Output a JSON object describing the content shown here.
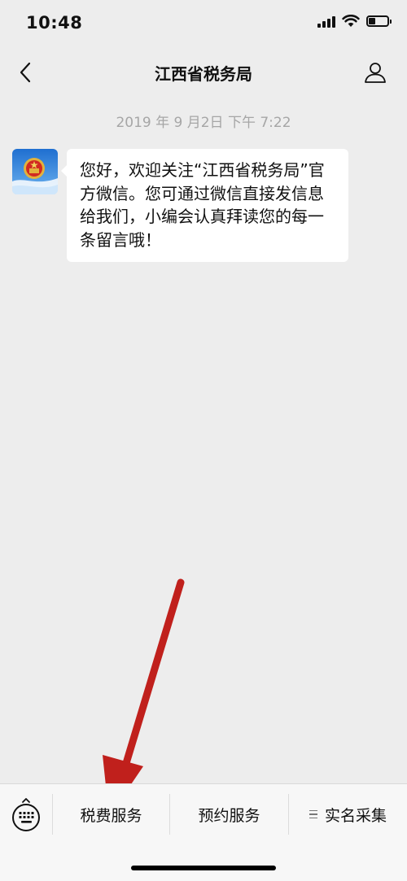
{
  "status_bar": {
    "time": "10:48"
  },
  "nav": {
    "title": "江西省税务局"
  },
  "chat": {
    "timestamp": "2019 年 9 月2日 下午 7:22",
    "message": "您好，欢迎关注“江西省税务局”官方微信。您可通过微信直接发信息给我们，小编会认真拜读您的每一条留言哦！"
  },
  "bottom_menu": {
    "items": [
      {
        "label": "税费服务"
      },
      {
        "label": "预约服务"
      },
      {
        "label": "实名采集"
      }
    ]
  },
  "colors": {
    "background": "#ededed",
    "bubble": "#ffffff",
    "timestamp_text": "#a6a6a6",
    "menu_background": "#f7f7f7",
    "annotation_arrow": "#c0201c"
  }
}
